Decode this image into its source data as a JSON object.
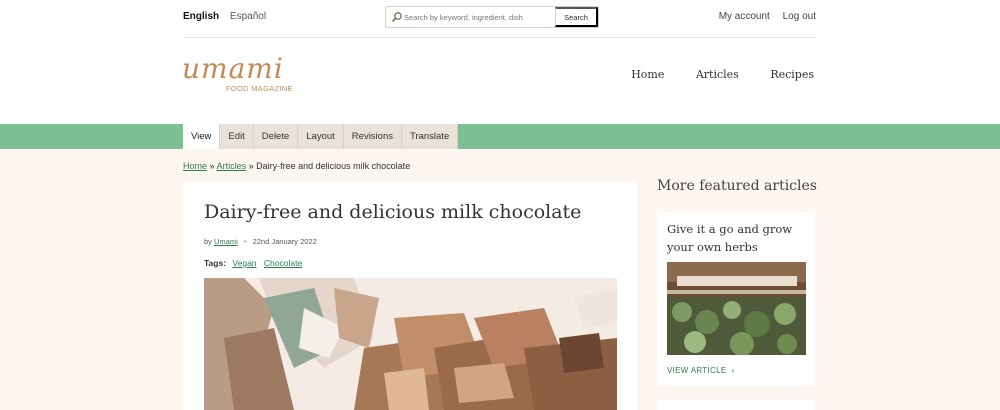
{
  "languages": {
    "active": "English",
    "other": "Español"
  },
  "search": {
    "placeholder": "Search by keyword, ingredient, dish",
    "button": "Search"
  },
  "account": {
    "my_account": "My account",
    "logout": "Log out"
  },
  "logo": {
    "word": "umami",
    "sub": "FOOD MAGAZINE",
    "color": "#c58a54"
  },
  "nav": {
    "items": [
      "Home",
      "Articles",
      "Recipes"
    ]
  },
  "tabs": {
    "items": [
      "View",
      "Edit",
      "Delete",
      "Layout",
      "Revisions",
      "Translate"
    ],
    "active": "View"
  },
  "breadcrumb": {
    "home": "Home",
    "articles": "Articles",
    "separator": "»",
    "current": "Dairy-free and delicious milk chocolate"
  },
  "article": {
    "title": "Dairy-free and delicious milk chocolate",
    "by": "by",
    "author": "Umami",
    "date": "22nd January 2022",
    "tags_label": "Tags:",
    "tags": [
      "Vegan",
      "Chocolate"
    ]
  },
  "sidebar": {
    "title": "More featured articles",
    "card": {
      "title": "Give it a go and grow your own herbs",
      "link": "VIEW ARTICLE"
    }
  },
  "colors": {
    "accent_green": "#7ec095",
    "link_green": "#2e7d4e",
    "page_bg": "#fdf6f0"
  }
}
